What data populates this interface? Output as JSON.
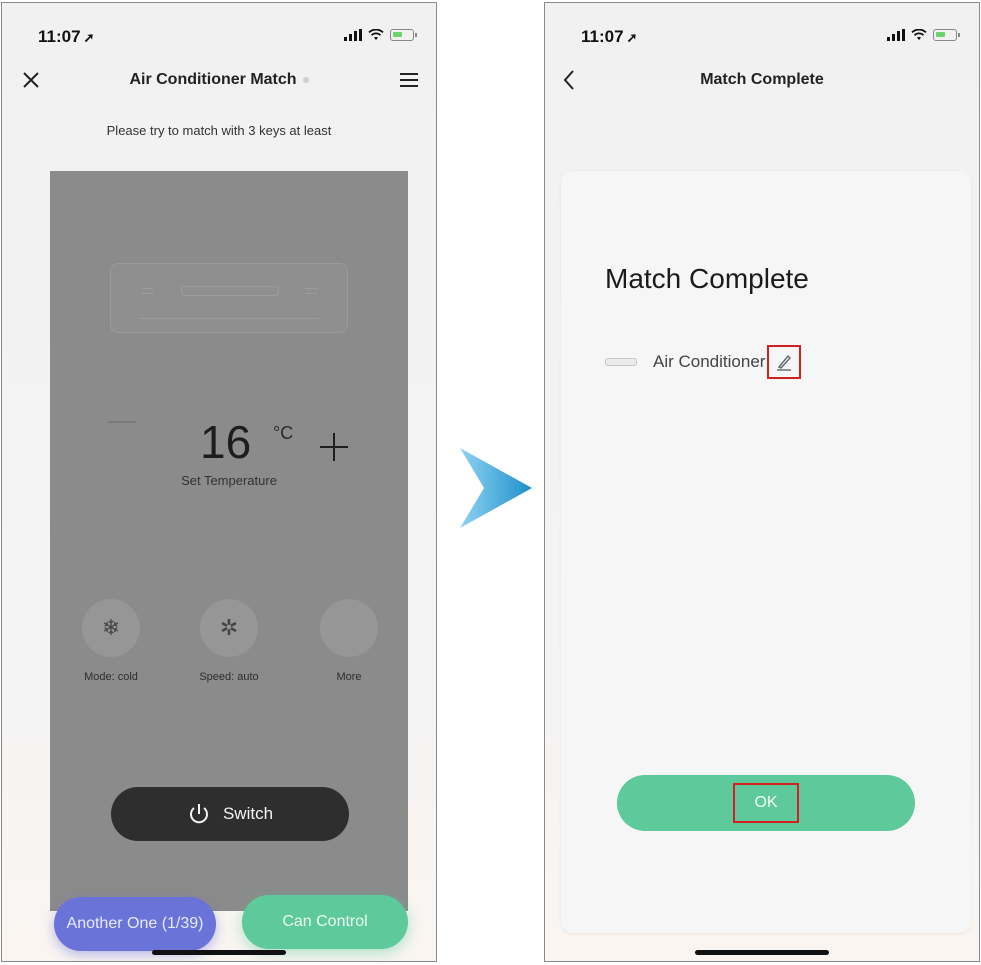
{
  "left_screen": {
    "status": {
      "time": "11:07"
    },
    "nav": {
      "title": "Air Conditioner Match"
    },
    "hint": "Please try to match with 3 keys at least",
    "remote": {
      "temperature": "16",
      "unit": "°C",
      "temp_label": "Set Temperature",
      "controls": [
        {
          "label": "Mode: cold",
          "icon": "snowflake-icon"
        },
        {
          "label": "Speed: auto",
          "icon": "fan-icon"
        },
        {
          "label": "More",
          "icon": "more-icon"
        }
      ],
      "switch_label": "Switch"
    },
    "buttons": {
      "another": "Another One (1/39)",
      "can_control": "Can Control"
    }
  },
  "right_screen": {
    "status": {
      "time": "11:07"
    },
    "nav": {
      "title": "Match Complete"
    },
    "card": {
      "heading": "Match Complete",
      "device_name": "Air Conditioner",
      "ok_label": "OK"
    }
  },
  "colors": {
    "accent_green": "#5ec99a",
    "accent_blue": "#6a74d8",
    "highlight_red": "#d32020",
    "arrow_blue": "#2a9fd6"
  }
}
